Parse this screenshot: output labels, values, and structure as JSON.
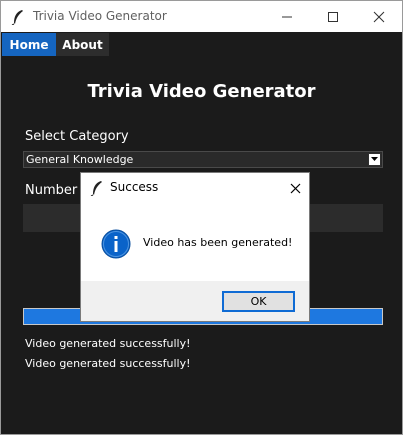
{
  "window": {
    "title": "Trivia Video Generator",
    "accent": "#1565c0"
  },
  "tabs": [
    {
      "label": "Home",
      "active": true
    },
    {
      "label": "About",
      "active": false
    }
  ],
  "main": {
    "title": "Trivia Video Generator",
    "category_label": "Select Category",
    "category_value": "General Knowledge",
    "number_label": "Number o",
    "number_value": "",
    "progress_percent": 100,
    "status_lines": [
      "Video generated successfully!",
      "Video generated successfully!"
    ]
  },
  "dialog": {
    "title": "Success",
    "message": "Video has been generated!",
    "ok_label": "OK",
    "icon": "info-icon",
    "info_color": "#0a63c9"
  }
}
